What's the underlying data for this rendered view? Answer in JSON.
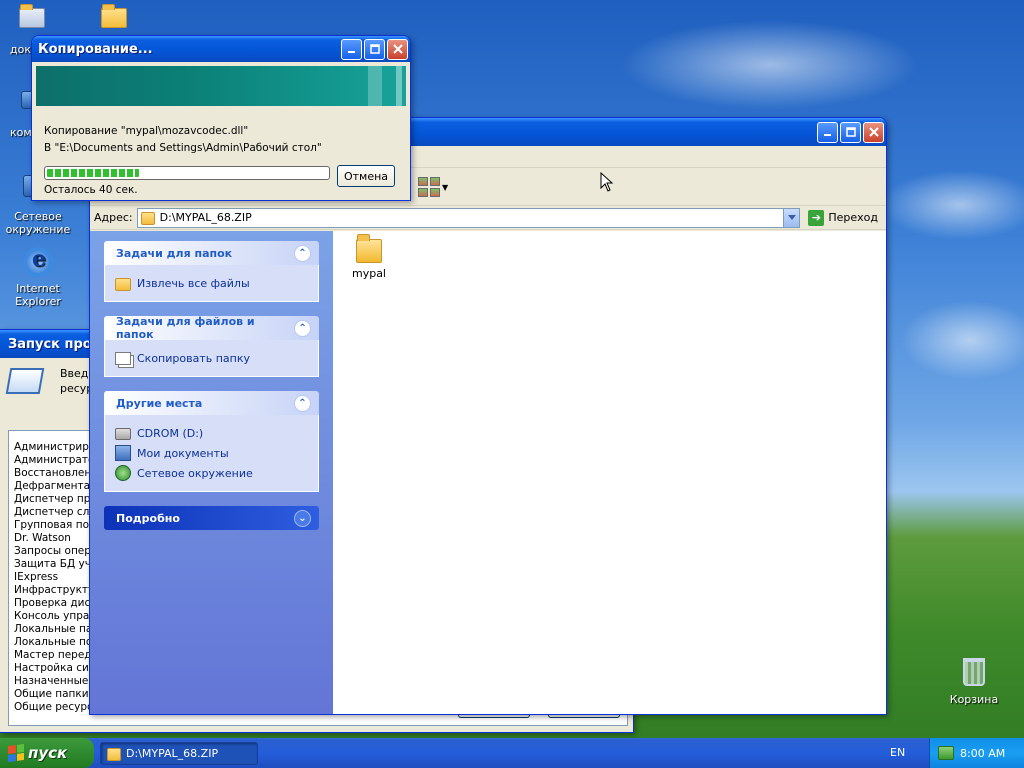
{
  "colors": {
    "titlebar": "#0554d6",
    "taskpane": "#6375d6",
    "start_green": "#2f8a2f",
    "progress_green": "#2fbf2f",
    "link_blue": "#0c3097"
  },
  "desktop": {
    "icons": [
      {
        "label": "Сетевое окружение",
        "icon": "network-places-icon"
      },
      {
        "label": "Internet Explorer",
        "icon": "internet-explorer-icon"
      },
      {
        "label": "Корзина",
        "icon": "recycle-bin-icon"
      }
    ],
    "partial_labels": {
      "top_left_1": "док",
      "top_left_2": "ком"
    }
  },
  "explorer": {
    "title": "D:\\MYPAL_68.ZIP",
    "address_label": "Адрес:",
    "address_value": "D:\\MYPAL_68.ZIP",
    "go_label": "Переход",
    "task_groups": {
      "folder_tasks": {
        "title": "Задачи для папок",
        "items": [
          "Извлечь все файлы"
        ]
      },
      "file_tasks": {
        "title": "Задачи для файлов и папок",
        "items": [
          "Скопировать папку"
        ]
      },
      "other_places": {
        "title": "Другие места",
        "items": [
          "CDROM (D:)",
          "Мои документы",
          "Сетевое окружение"
        ]
      },
      "details": {
        "title": "Подробно"
      }
    },
    "files": [
      {
        "name": "mypal",
        "icon": "folder-icon"
      }
    ]
  },
  "copy_dialog": {
    "title": "Копирование...",
    "line_file": "Копирование \"mypal\\mozavcodec.dll\"",
    "line_dest": "В \"E:\\Documents and Settings\\Admin\\Рабочий стол\"",
    "remaining": "Осталось 40 сек.",
    "progress_fraction": 0.33,
    "cancel_label": "Отмена"
  },
  "run_dialog": {
    "title": "Запуск прогр",
    "desc_line1": "Введ",
    "desc_line2": "ресур",
    "items": [
      "Администрирова",
      "Администратор",
      "Восстановлени",
      "Дефрагментац",
      "Диспетчер про",
      "Диспетчер слу",
      "Групповая пол",
      "Dr. Watson",
      "Запросы опера",
      "Защита БД уче",
      "IExpress",
      "Инфраструкту",
      "Проверка диск",
      "Консоль управ",
      "Локальные пар",
      "Локальные пол",
      "Мастер переда",
      "Настройка сис",
      "Назначенные з",
      "Общие папки",
      "Общие ресурс"
    ]
  },
  "taskbar": {
    "start_label": "пуск",
    "task_label": "D:\\MYPAL_68.ZIP",
    "lang": "EN",
    "time": "8:00 AM"
  }
}
